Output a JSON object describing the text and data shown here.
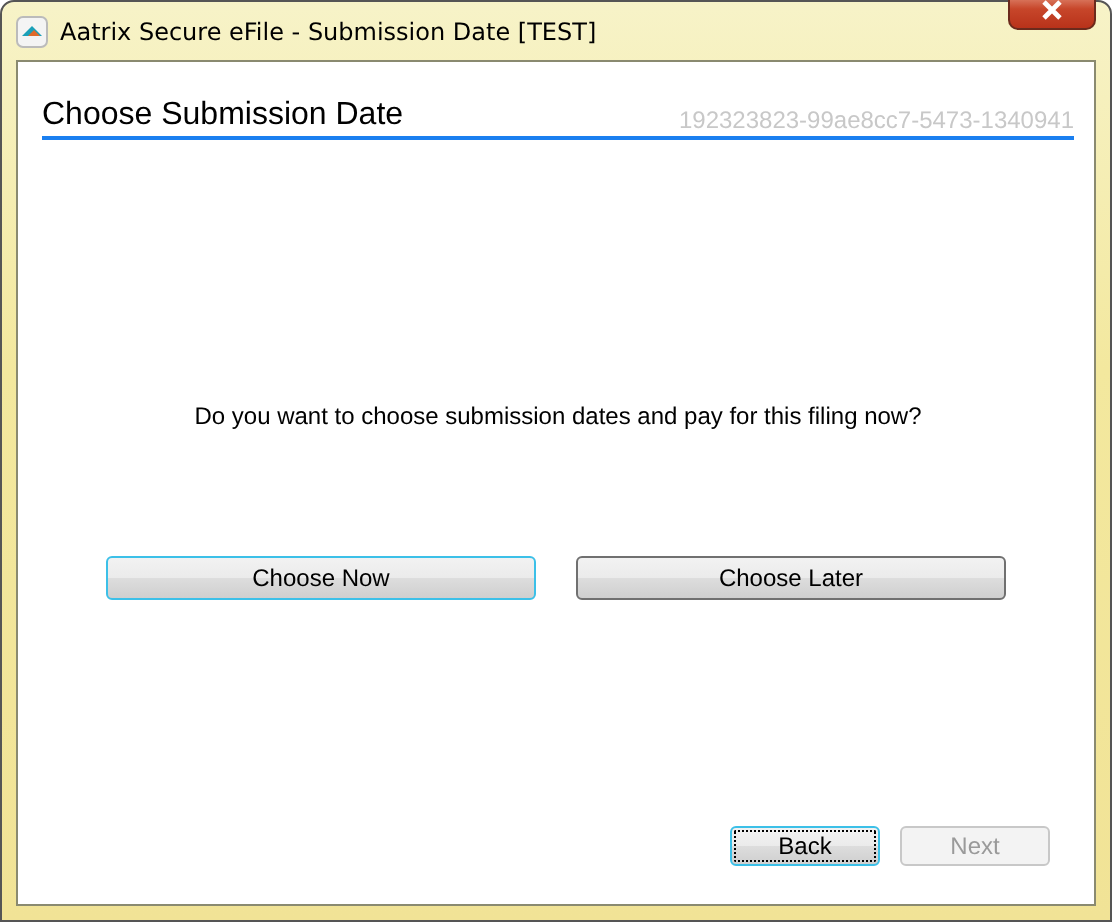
{
  "window": {
    "title": "Aatrix Secure eFile - Submission Date [TEST]"
  },
  "header": {
    "title": "Choose Submission Date",
    "id_text": "192323823-99ae8cc7-5473-1340941"
  },
  "question": "Do you want to choose submission dates and pay for this filing now?",
  "choices": [
    {
      "label": "Choose Now",
      "focused": true
    },
    {
      "label": "Choose Later",
      "focused": false
    }
  ],
  "nav_buttons": [
    {
      "label": "Back",
      "focused": true,
      "disabled": false
    },
    {
      "label": "Next",
      "focused": false,
      "disabled": true
    }
  ]
}
